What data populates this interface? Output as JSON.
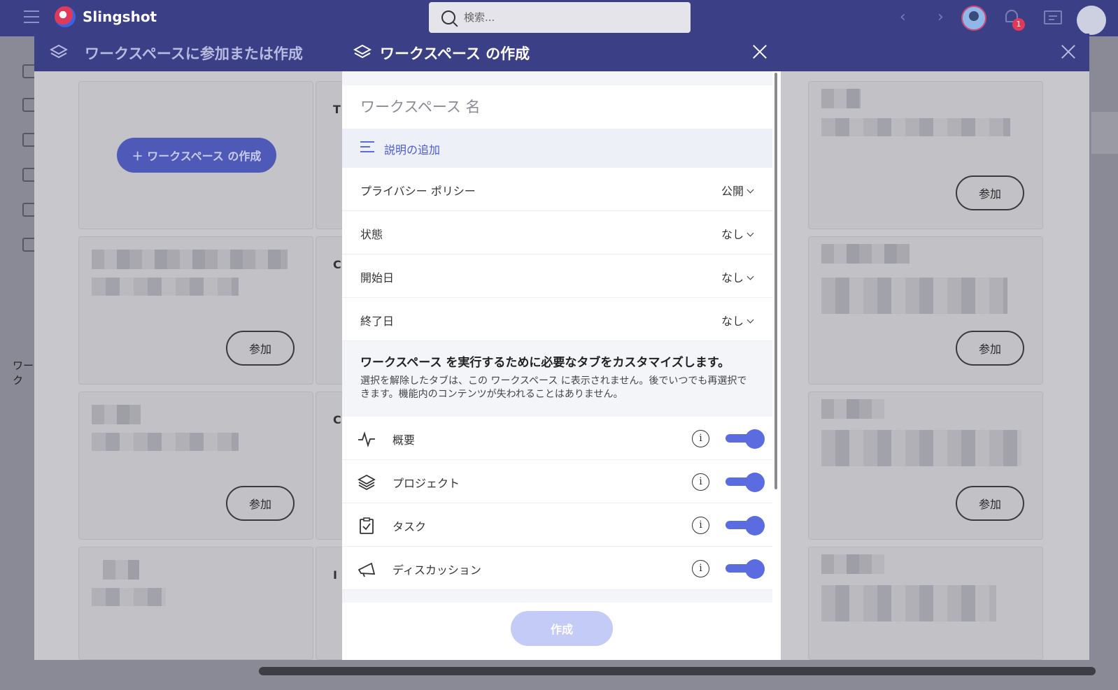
{
  "topbar": {
    "brand": "Slingshot",
    "search_placeholder": "検索...",
    "notification_count": "1"
  },
  "sidebar": {
    "section_label": "ワーク"
  },
  "outer_modal": {
    "title": "ワークスペースに参加または作成",
    "create_button": "ワークスペース の作成",
    "join_label": "参加",
    "middle_letters": [
      "T",
      "C",
      "C",
      "I"
    ]
  },
  "dialog": {
    "title": "ワークスペース の作成",
    "name_placeholder": "ワークスペース 名",
    "add_description": "説明の追加",
    "options": [
      {
        "label": "プライバシー ポリシー",
        "value": "公開"
      },
      {
        "label": "状態",
        "value": "なし"
      },
      {
        "label": "開始日",
        "value": "なし"
      },
      {
        "label": "終了日",
        "value": "なし"
      }
    ],
    "customize_heading": "ワークスペース を実行するために必要なタブをカスタマイズします。",
    "customize_text": "選択を解除したタブは、この ワークスペース に表示されません。後でいつでも再選択できます。機能内のコンテンツが失われることはありません。",
    "tabs": [
      {
        "label": "概要",
        "icon": "activity-icon",
        "enabled": true
      },
      {
        "label": "プロジェクト",
        "icon": "layers-icon",
        "enabled": true
      },
      {
        "label": "タスク",
        "icon": "clipboard-check-icon",
        "enabled": true
      },
      {
        "label": "ディスカッション",
        "icon": "megaphone-icon",
        "enabled": true
      }
    ],
    "info_glyph": "i",
    "submit_label": "作成"
  },
  "colors": {
    "header": "#3a3f86",
    "accent": "#5b6be0",
    "submit_disabled": "#c4cbf6"
  }
}
